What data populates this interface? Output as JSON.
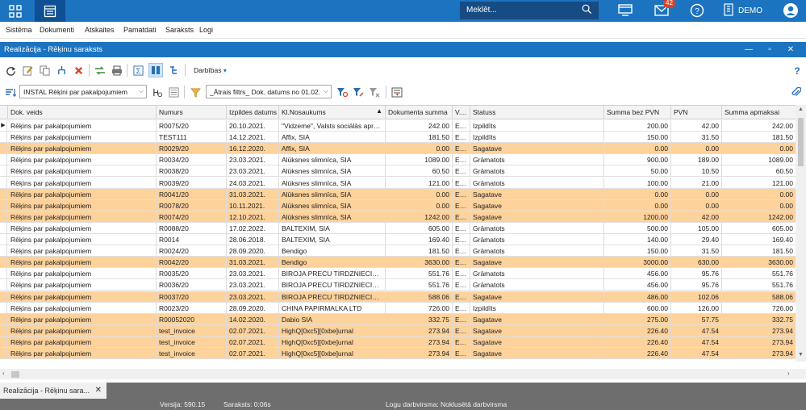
{
  "topbar": {
    "search_placeholder": "Meklēt...",
    "mail_badge": "42",
    "user": "DEMO"
  },
  "menu": [
    "Sistēma",
    "Dokumenti",
    "Atskaites",
    "Pamatdati",
    "Saraksts",
    "Logi"
  ],
  "window": {
    "title": "Realizācija - Rēķinu saraksts"
  },
  "toolbar": {
    "actions_label": "Darbības",
    "doc_type_combo": "INSTAL Rēķini par pakalpojumiem",
    "filter_combo": "_Ātrais filtrs_ Dok. datums no 01.02."
  },
  "columns": [
    "Dok. veids",
    "Numurs",
    "Izpildes datums",
    "Kl.Nosaukums",
    "Dokumenta summa",
    "V....",
    "Statuss",
    "Summa bez PVN",
    "PVN",
    "Summa apmaksai"
  ],
  "rows": [
    {
      "veids": "Rēķins par pakalpojumiem",
      "numurs": "R0075/20",
      "datums": "20.10.2021.",
      "klients": "\"Vidzeme\", Valsts sociālās aprū...",
      "summa": "242.00",
      "val": "EUR",
      "statuss": "Izpildīts",
      "bez_pvn": "200.00",
      "pvn": "42.00",
      "apmaksai": "242.00",
      "sag": false
    },
    {
      "veids": "Rēķins par pakalpojumiem",
      "numurs": "TEST111",
      "datums": "14.12.2021.",
      "klients": "Affix, SIA",
      "summa": "181.50",
      "val": "EUR",
      "statuss": "Izpildīts",
      "bez_pvn": "150.00",
      "pvn": "31.50",
      "apmaksai": "181.50",
      "sag": false
    },
    {
      "veids": "Rēķins par pakalpojumiem",
      "numurs": "R0029/20",
      "datums": "16.12.2020.",
      "klients": "Affix, SIA",
      "summa": "0.00",
      "val": "EUR",
      "statuss": "Sagatave",
      "bez_pvn": "0.00",
      "pvn": "0.00",
      "apmaksai": "0.00",
      "sag": true
    },
    {
      "veids": "Rēķins par pakalpojumiem",
      "numurs": "R0034/20",
      "datums": "23.03.2021.",
      "klients": "Alūksnes slimnīca, SIA",
      "summa": "1089.00",
      "val": "EUR",
      "statuss": "Grāmatots",
      "bez_pvn": "900.00",
      "pvn": "189.00",
      "apmaksai": "1089.00",
      "sag": false
    },
    {
      "veids": "Rēķins par pakalpojumiem",
      "numurs": "R0038/20",
      "datums": "23.03.2021.",
      "klients": "Alūksnes slimnīca, SIA",
      "summa": "60.50",
      "val": "EUR",
      "statuss": "Grāmatots",
      "bez_pvn": "50.00",
      "pvn": "10.50",
      "apmaksai": "60.50",
      "sag": false
    },
    {
      "veids": "Rēķins par pakalpojumiem",
      "numurs": "R0039/20",
      "datums": "24.03.2021.",
      "klients": "Alūksnes slimnīca, SIA",
      "summa": "121.00",
      "val": "EUR",
      "statuss": "Grāmatots",
      "bez_pvn": "100.00",
      "pvn": "21.00",
      "apmaksai": "121.00",
      "sag": false
    },
    {
      "veids": "Rēķins par pakalpojumiem",
      "numurs": "R0041/20",
      "datums": "31.03.2021.",
      "klients": "Alūksnes slimnīca, SIA",
      "summa": "0.00",
      "val": "EUR",
      "statuss": "Sagatave",
      "bez_pvn": "0.00",
      "pvn": "0.00",
      "apmaksai": "0.00",
      "sag": true
    },
    {
      "veids": "Rēķins par pakalpojumiem",
      "numurs": "R0078/20",
      "datums": "10.11.2021.",
      "klients": "Alūksnes slimnīca, SIA",
      "summa": "0.00",
      "val": "EUR",
      "statuss": "Sagatave",
      "bez_pvn": "0.00",
      "pvn": "0.00",
      "apmaksai": "0.00",
      "sag": true
    },
    {
      "veids": "Rēķins par pakalpojumiem",
      "numurs": "R0074/20",
      "datums": "12.10.2021.",
      "klients": "Alūksnes slimnīca, SIA",
      "summa": "1242.00",
      "val": "EUR",
      "statuss": "Sagatave",
      "bez_pvn": "1200.00",
      "pvn": "42.00",
      "apmaksai": "1242.00",
      "sag": true
    },
    {
      "veids": "Rēķins par pakalpojumiem",
      "numurs": "R0088/20",
      "datums": "17.02.2022.",
      "klients": "BALTEXIM, SIA",
      "summa": "605.00",
      "val": "EUR",
      "statuss": "Grāmatots",
      "bez_pvn": "500.00",
      "pvn": "105.00",
      "apmaksai": "605.00",
      "sag": false
    },
    {
      "veids": "Rēķins par pakalpojumiem",
      "numurs": "R0014",
      "datums": "28.06.2018.",
      "klients": "BALTEXIM, SIA",
      "summa": "169.40",
      "val": "EUR",
      "statuss": "Grāmatots",
      "bez_pvn": "140.00",
      "pvn": "29.40",
      "apmaksai": "169.40",
      "sag": false
    },
    {
      "veids": "Rēķins par pakalpojumiem",
      "numurs": "R0024/20",
      "datums": "28.09.2020.",
      "klients": "Bendigo",
      "summa": "181.50",
      "val": "EUR",
      "statuss": "Grāmatots",
      "bez_pvn": "150.00",
      "pvn": "31.50",
      "apmaksai": "181.50",
      "sag": false
    },
    {
      "veids": "Rēķins par pakalpojumiem",
      "numurs": "R0042/20",
      "datums": "31.03.2021.",
      "klients": "Bendigo",
      "summa": "3630.00",
      "val": "EUR",
      "statuss": "Sagatave",
      "bez_pvn": "3000.00",
      "pvn": "630.00",
      "apmaksai": "3630.00",
      "sag": true
    },
    {
      "veids": "Rēķins par pakalpojumiem",
      "numurs": "R0035/20",
      "datums": "23.03.2021.",
      "klients": "BIROJA PRECU TIRDZNIECIBA...",
      "summa": "551.76",
      "val": "EUR",
      "statuss": "Grāmatots",
      "bez_pvn": "456.00",
      "pvn": "95.76",
      "apmaksai": "551.76",
      "sag": false
    },
    {
      "veids": "Rēķins par pakalpojumiem",
      "numurs": "R0036/20",
      "datums": "23.03.2021.",
      "klients": "BIROJA PRECU TIRDZNIECIBA...",
      "summa": "551.76",
      "val": "EUR",
      "statuss": "Grāmatots",
      "bez_pvn": "456.00",
      "pvn": "95.76",
      "apmaksai": "551.76",
      "sag": false
    },
    {
      "veids": "Rēķins par pakalpojumiem",
      "numurs": "R0037/20",
      "datums": "23.03.2021.",
      "klients": "BIROJA PRECU TIRDZNIECIBA...",
      "summa": "588.06",
      "val": "EUR",
      "statuss": "Sagatave",
      "bez_pvn": "486.00",
      "pvn": "102.06",
      "apmaksai": "588.06",
      "sag": true
    },
    {
      "veids": "Rēķins par pakalpojumiem",
      "numurs": "R0023/20",
      "datums": "28.09.2020.",
      "klients": "CHINA PAPIRMALKA LTD",
      "summa": "726.00",
      "val": "EUR",
      "statuss": "Izpildīts",
      "bez_pvn": "600.00",
      "pvn": "126.00",
      "apmaksai": "726.00",
      "sag": false
    },
    {
      "veids": "Rēķins par pakalpojumiem",
      "numurs": "R00052020",
      "datums": "14.02.2020.",
      "klients": "Dabio SIA",
      "summa": "332.75",
      "val": "EUR",
      "statuss": "Sagatave",
      "bez_pvn": "275.00",
      "pvn": "57.75",
      "apmaksai": "332.75",
      "sag": true
    },
    {
      "veids": "Rēķins par pakalpojumiem",
      "numurs": "test_invoice",
      "datums": "02.07.2021.",
      "klients": "HighQ[0xc5][0xbe]urnal",
      "summa": "273.94",
      "val": "EUR",
      "statuss": "Sagatave",
      "bez_pvn": "226.40",
      "pvn": "47.54",
      "apmaksai": "273.94",
      "sag": true
    },
    {
      "veids": "Rēķins par pakalpojumiem",
      "numurs": "test_invoice",
      "datums": "02.07.2021.",
      "klients": "HighQ[0xc5][0xbe]urnal",
      "summa": "273.94",
      "val": "EUR",
      "statuss": "Sagatave",
      "bez_pvn": "226.40",
      "pvn": "47.54",
      "apmaksai": "273.94",
      "sag": true
    },
    {
      "veids": "Rēķins par pakalpojumiem",
      "numurs": "test_invoice",
      "datums": "02.07.2021.",
      "klients": "HighQ[0xc5][0xbe]urnal",
      "summa": "273.94",
      "val": "EUR",
      "statuss": "Sagatave",
      "bez_pvn": "226.40",
      "pvn": "47.54",
      "apmaksai": "273.94",
      "sag": true
    }
  ],
  "doc_tab": "Realizācija - Rēķinu sara...",
  "status": {
    "version": "Versija: 590.15",
    "list": "Saraksts: 0:06s",
    "log": "Logu darbvirsma: Noklusētā darbvirsma"
  },
  "colors": {
    "accent": "#1c73c0",
    "draft_row": "#fdd29b"
  }
}
